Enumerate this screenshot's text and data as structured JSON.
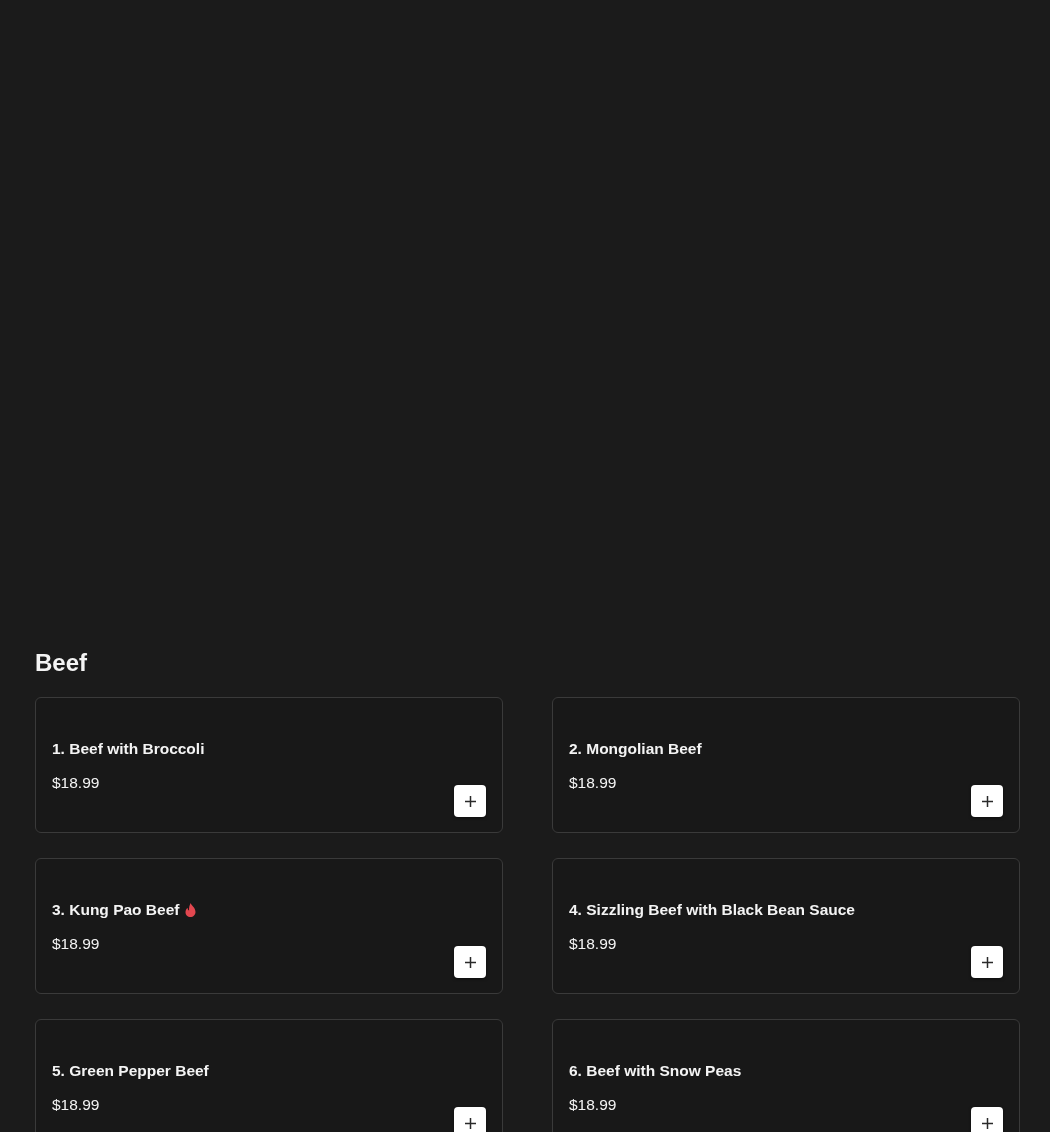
{
  "section": {
    "title": "Beef"
  },
  "items": [
    {
      "name": "1. Beef with Broccoli",
      "price": "$18.99",
      "spicy": false
    },
    {
      "name": "2. Mongolian Beef",
      "price": "$18.99",
      "spicy": false
    },
    {
      "name": "3. Kung Pao Beef",
      "price": "$18.99",
      "spicy": true
    },
    {
      "name": "4. Sizzling Beef with Black Bean Sauce",
      "price": "$18.99",
      "spicy": false
    },
    {
      "name": "5. Green Pepper Beef",
      "price": "$18.99",
      "spicy": false
    },
    {
      "name": "6. Beef with Snow Peas",
      "price": "$18.99",
      "spicy": false
    }
  ]
}
